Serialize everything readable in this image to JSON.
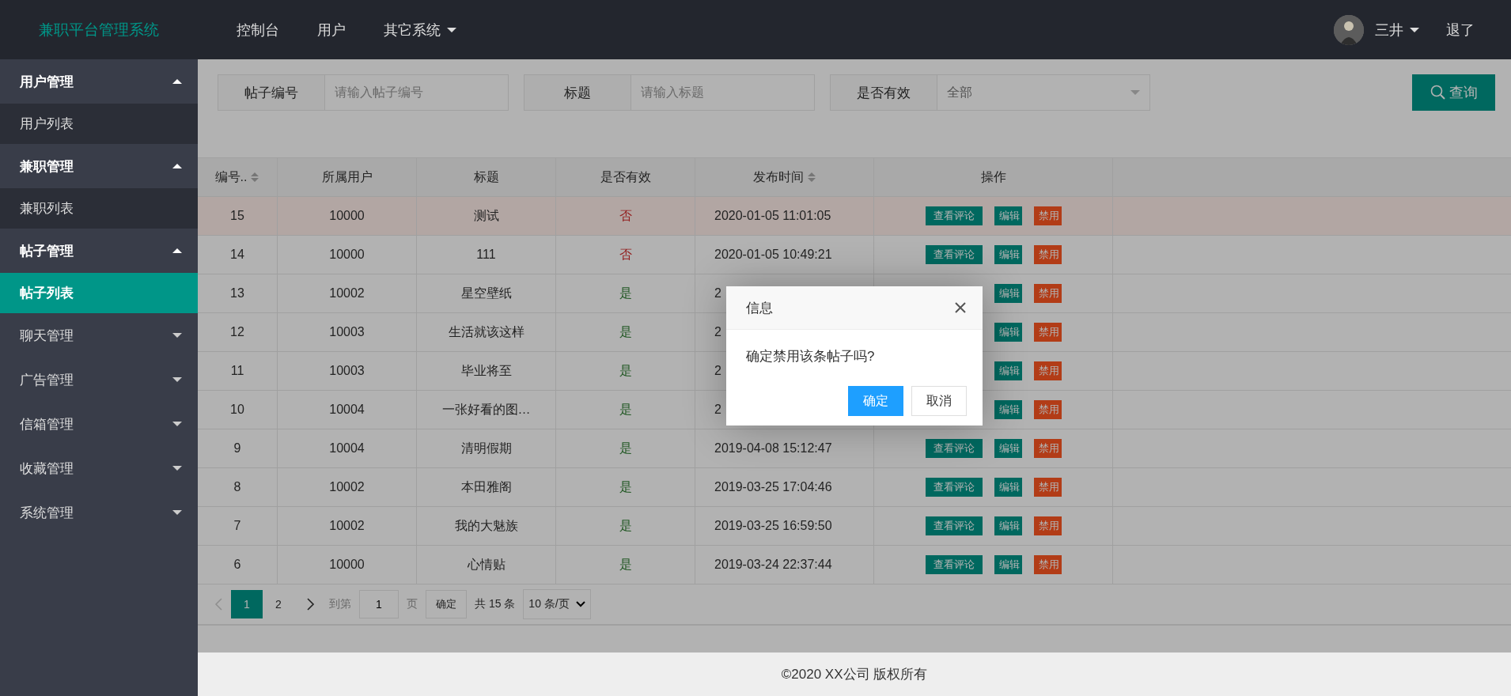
{
  "header": {
    "title": "兼职平台管理系统",
    "nav": [
      {
        "label": "控制台",
        "dropdown": false
      },
      {
        "label": "用户",
        "dropdown": false
      },
      {
        "label": "其它系统",
        "dropdown": true
      }
    ],
    "user": {
      "name": "三井"
    },
    "logout": "退了"
  },
  "sidebar": [
    {
      "label": "用户管理",
      "expanded": true,
      "children": [
        {
          "label": "用户列表",
          "selected": false
        }
      ]
    },
    {
      "label": "兼职管理",
      "expanded": true,
      "children": [
        {
          "label": "兼职列表",
          "selected": false
        }
      ]
    },
    {
      "label": "帖子管理",
      "expanded": true,
      "children": [
        {
          "label": "帖子列表",
          "selected": true
        }
      ]
    },
    {
      "label": "聊天管理",
      "expanded": false
    },
    {
      "label": "广告管理",
      "expanded": false
    },
    {
      "label": "信箱管理",
      "expanded": false
    },
    {
      "label": "收藏管理",
      "expanded": false
    },
    {
      "label": "系统管理",
      "expanded": false
    }
  ],
  "search": {
    "fields": [
      {
        "kind": "text",
        "label": "帖子编号",
        "placeholder": "请输入帖子编号"
      },
      {
        "kind": "text",
        "label": "标题",
        "placeholder": "请输入标题"
      },
      {
        "kind": "select",
        "label": "是否有效",
        "value": "全部"
      }
    ],
    "button": "查询"
  },
  "table": {
    "columns": [
      {
        "label": "编号..",
        "sortable": true
      },
      {
        "label": "所属用户",
        "sortable": false
      },
      {
        "label": "标题",
        "sortable": false
      },
      {
        "label": "是否有效",
        "sortable": false
      },
      {
        "label": "发布时间",
        "sortable": true
      },
      {
        "label": "操作",
        "sortable": false
      }
    ],
    "rows": [
      {
        "id": "15",
        "user": "10000",
        "title": "测试",
        "valid": false,
        "valid_text": "否",
        "time": "2020-01-05 11:01:05",
        "hovered": true,
        "actions": [
          {
            "kind": "view",
            "label": "查看评论"
          },
          {
            "kind": "edit",
            "label": "编辑"
          },
          {
            "kind": "disable",
            "label": "禁用"
          }
        ]
      },
      {
        "id": "14",
        "user": "10000",
        "title": "111",
        "valid": false,
        "valid_text": "否",
        "time": "2020-01-05 10:49:21",
        "hovered": false,
        "actions": [
          {
            "kind": "view",
            "label": "查看评论"
          },
          {
            "kind": "edit",
            "label": "编辑"
          },
          {
            "kind": "disable",
            "label": "禁用"
          }
        ]
      },
      {
        "id": "13",
        "user": "10002",
        "title": "星空壁纸",
        "valid": true,
        "valid_text": "是",
        "time": "2",
        "hovered": false,
        "actions": [
          {
            "kind": "edit",
            "label": "编辑"
          },
          {
            "kind": "disable",
            "label": "禁用"
          }
        ]
      },
      {
        "id": "12",
        "user": "10003",
        "title": "生活就该这样",
        "valid": true,
        "valid_text": "是",
        "time": "2",
        "hovered": false,
        "actions": [
          {
            "kind": "edit",
            "label": "编辑"
          },
          {
            "kind": "disable",
            "label": "禁用"
          }
        ]
      },
      {
        "id": "11",
        "user": "10003",
        "title": "毕业将至",
        "valid": true,
        "valid_text": "是",
        "time": "2",
        "hovered": false,
        "actions": [
          {
            "kind": "edit",
            "label": "编辑"
          },
          {
            "kind": "disable",
            "label": "禁用"
          }
        ]
      },
      {
        "id": "10",
        "user": "10004",
        "title": "一张好看的图…",
        "valid": true,
        "valid_text": "是",
        "time": "2",
        "hovered": false,
        "actions": [
          {
            "kind": "edit",
            "label": "编辑"
          },
          {
            "kind": "disable",
            "label": "禁用"
          }
        ]
      },
      {
        "id": "9",
        "user": "10004",
        "title": "清明假期",
        "valid": true,
        "valid_text": "是",
        "time": "2019-04-08 15:12:47",
        "hovered": false,
        "actions": [
          {
            "kind": "view",
            "label": "查看评论"
          },
          {
            "kind": "edit",
            "label": "编辑"
          },
          {
            "kind": "disable",
            "label": "禁用"
          }
        ]
      },
      {
        "id": "8",
        "user": "10002",
        "title": "本田雅阁",
        "valid": true,
        "valid_text": "是",
        "time": "2019-03-25 17:04:46",
        "hovered": false,
        "actions": [
          {
            "kind": "view",
            "label": "查看评论"
          },
          {
            "kind": "edit",
            "label": "编辑"
          },
          {
            "kind": "disable",
            "label": "禁用"
          }
        ]
      },
      {
        "id": "7",
        "user": "10002",
        "title": "我的大魅族",
        "valid": true,
        "valid_text": "是",
        "time": "2019-03-25 16:59:50",
        "hovered": false,
        "actions": [
          {
            "kind": "view",
            "label": "查看评论"
          },
          {
            "kind": "edit",
            "label": "编辑"
          },
          {
            "kind": "disable",
            "label": "禁用"
          }
        ]
      },
      {
        "id": "6",
        "user": "10000",
        "title": "心情贴",
        "valid": true,
        "valid_text": "是",
        "time": "2019-03-24 22:37:44",
        "hovered": false,
        "actions": [
          {
            "kind": "view",
            "label": "查看评论"
          },
          {
            "kind": "edit",
            "label": "编辑"
          },
          {
            "kind": "disable",
            "label": "禁用"
          }
        ]
      }
    ]
  },
  "pager": {
    "pages": [
      {
        "label": "1",
        "selected": true
      },
      {
        "label": "2",
        "selected": false
      }
    ],
    "goto_label": "到第",
    "page_input": "1",
    "page_unit": "页",
    "confirm": "确定",
    "total": "共 15 条",
    "page_size": "10 条/页"
  },
  "dialog": {
    "title": "信息",
    "message": "确定禁用该条帖子吗?",
    "buttons": [
      {
        "kind": "primary",
        "label": "确定"
      },
      {
        "kind": "default",
        "label": "取消"
      }
    ]
  },
  "footer": "©2020 XX公司 版权所有"
}
